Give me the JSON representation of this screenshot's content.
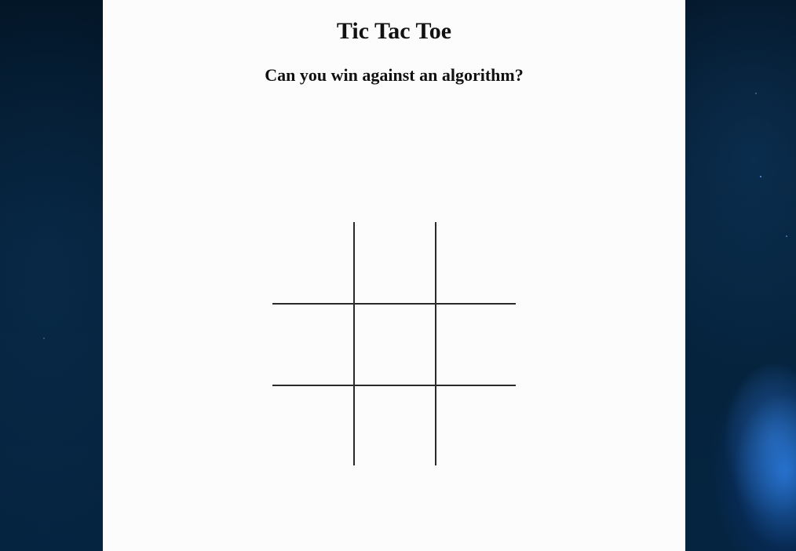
{
  "page": {
    "title": "Tic Tac Toe",
    "subtitle": "Can you win against an algorithm?"
  },
  "board": {
    "cells": [
      "",
      "",
      "",
      "",
      "",
      "",
      "",
      "",
      ""
    ]
  },
  "colors": {
    "panel_background": "#fcfcfc",
    "grid_line": "#2a2a2a",
    "space_accent": "#2878dc"
  }
}
